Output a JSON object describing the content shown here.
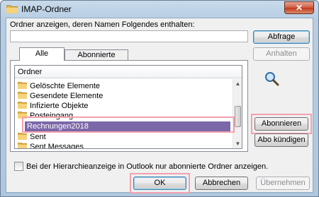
{
  "window": {
    "title": "IMAP-Ordner",
    "close_label": "✕"
  },
  "search": {
    "label": "Ordner anzeigen, deren Namen Folgendes enthalten:",
    "value": ""
  },
  "buttons": {
    "query": "Abfrage",
    "stop": "Anhalten",
    "subscribe": "Abonnieren",
    "unsubscribe": "Abo kündigen",
    "ok": "OK",
    "cancel": "Abbrechen",
    "apply": "Übernehmen"
  },
  "tabs": [
    {
      "label": "Alle"
    },
    {
      "label": "Abonnierte"
    }
  ],
  "list": {
    "header": "Ordner",
    "items": [
      {
        "label": "Gelöschte Elemente"
      },
      {
        "label": "Gesendete Elemente"
      },
      {
        "label": "Infizierte Objekte"
      },
      {
        "label": "Posteingang"
      },
      {
        "label": "Rechnungen2018"
      },
      {
        "label": "Sent"
      },
      {
        "label": "Sent Messages"
      }
    ]
  },
  "options": {
    "hierarchy_checkbox_label": "Bei der Hierarchieanzeige in Outlook nur abonnierte Ordner anzeigen."
  },
  "colors": {
    "selection": "#7b68a8",
    "highlight": "#f4a1ad"
  }
}
